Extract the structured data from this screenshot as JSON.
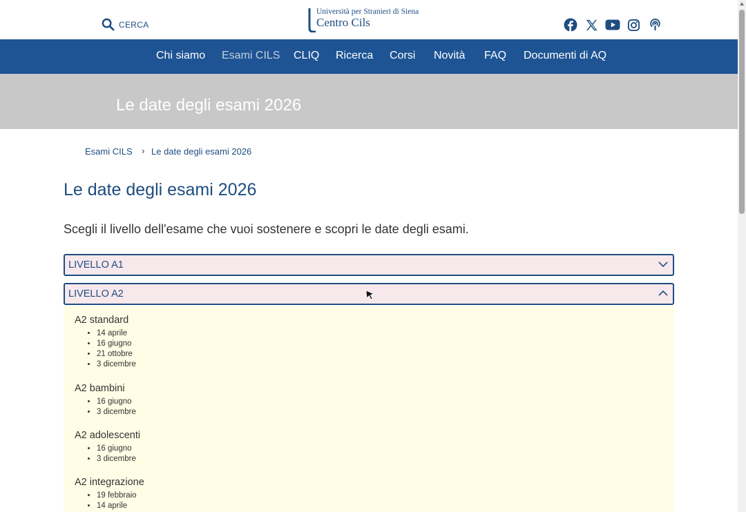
{
  "header": {
    "search_label": "CERCA",
    "logo": {
      "university": "Università per Stranieri di Siena",
      "name": "Centro Cils"
    },
    "social": [
      "facebook-icon",
      "x-icon",
      "youtube-icon",
      "instagram-icon",
      "podcast-icon"
    ]
  },
  "nav": {
    "items": [
      "Chi siamo",
      "Esami CILS",
      "CLIQ",
      "Ricerca",
      "Corsi",
      "Novità",
      "FAQ",
      "Documenti di AQ"
    ],
    "active": "Esami CILS"
  },
  "hero": {
    "title": "Le date degli esami 2026"
  },
  "breadcrumb": {
    "items": [
      "Esami CILS",
      "Le date degli esami 2026"
    ],
    "separator": "›"
  },
  "page": {
    "title": "Le date degli esami 2026",
    "intro": "Scegli il livello dell'esame che vuoi sostenere e scopri le date degli esami."
  },
  "accordion": [
    {
      "label": "LIVELLO A1",
      "expanded": false
    },
    {
      "label": "LIVELLO A2",
      "expanded": true,
      "groups": [
        {
          "title": "A2 standard",
          "dates": [
            "14 aprile",
            "16 giugno",
            "21 ottobre",
            "3 dicembre"
          ]
        },
        {
          "title": "A2 bambini",
          "dates": [
            "16 giugno",
            "3 dicembre"
          ]
        },
        {
          "title": "A2 adolescenti",
          "dates": [
            "16 giugno",
            "3 dicembre"
          ]
        },
        {
          "title": "A2 integrazione",
          "dates": [
            "19 febbraio",
            "14 aprile"
          ]
        }
      ]
    }
  ],
  "colors": {
    "brand_blue": "#1e5494",
    "text_blue": "#1e4d80",
    "hero_gray": "#c8c8c8",
    "accordion_head_bg": "#f7e8ec",
    "panel_bg": "#fffde6"
  }
}
